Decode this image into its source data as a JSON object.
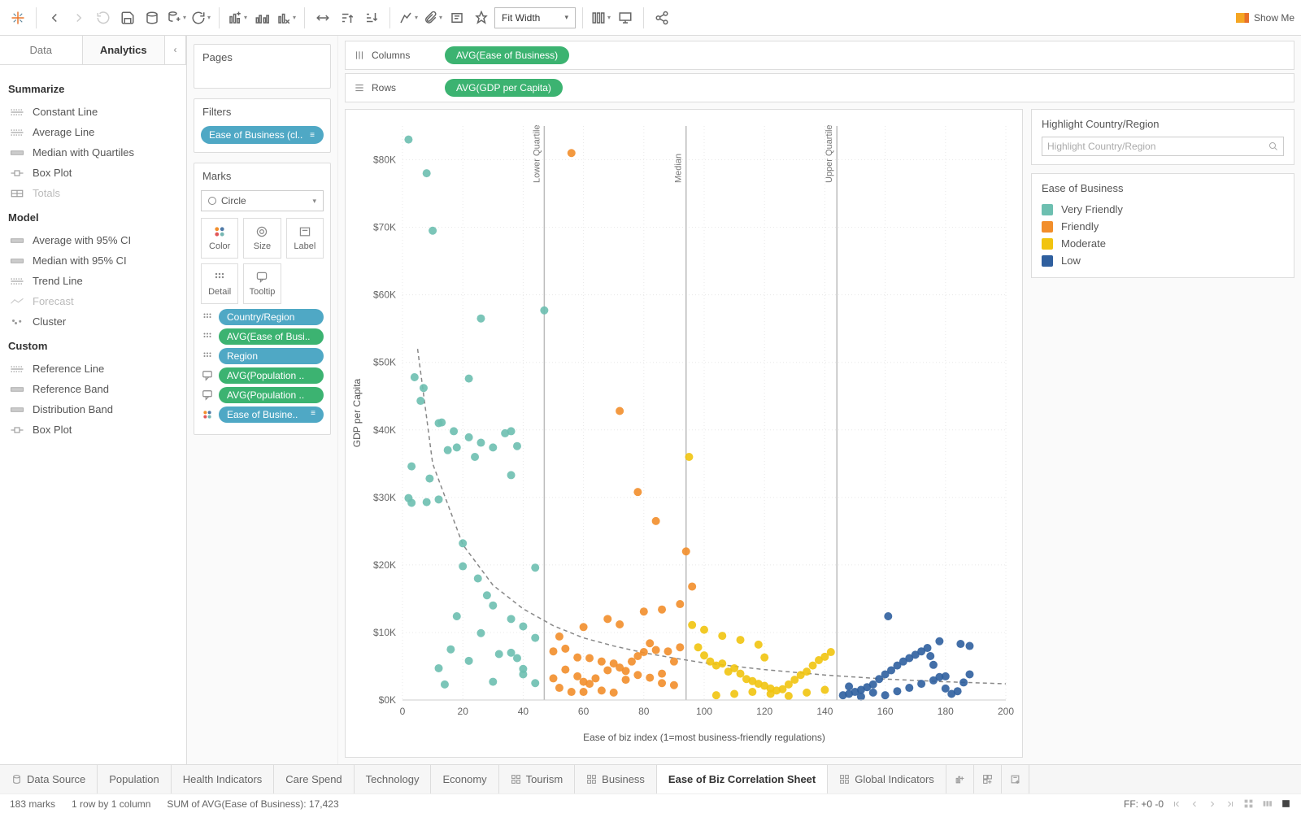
{
  "toolbar": {
    "fit_mode": "Fit Width",
    "show_me": "Show Me"
  },
  "sidepanel": {
    "tabs": {
      "data": "Data",
      "analytics": "Analytics"
    },
    "sections": {
      "summarize": {
        "title": "Summarize",
        "items": [
          "Constant Line",
          "Average Line",
          "Median with Quartiles",
          "Box Plot",
          "Totals"
        ]
      },
      "model": {
        "title": "Model",
        "items": [
          "Average with 95% CI",
          "Median with 95% CI",
          "Trend Line",
          "Forecast",
          "Cluster"
        ]
      },
      "custom": {
        "title": "Custom",
        "items": [
          "Reference Line",
          "Reference Band",
          "Distribution Band",
          "Box Plot"
        ]
      }
    }
  },
  "cards": {
    "pages": "Pages",
    "filters": {
      "title": "Filters",
      "pill": "Ease of Business (cl.."
    },
    "marks": {
      "title": "Marks",
      "type": "Circle",
      "cells": [
        "Color",
        "Size",
        "Label",
        "Detail",
        "Tooltip"
      ],
      "pills": [
        {
          "label": "Country/Region",
          "color": "blue",
          "icon": "detail"
        },
        {
          "label": "AVG(Ease of Busi..",
          "color": "green",
          "icon": "detail"
        },
        {
          "label": "Region",
          "color": "blue",
          "icon": "detail"
        },
        {
          "label": "AVG(Population ..",
          "color": "green",
          "icon": "tooltip"
        },
        {
          "label": "AVG(Population ..",
          "color": "green",
          "icon": "tooltip"
        },
        {
          "label": "Ease of Busine..",
          "color": "blue",
          "icon": "color",
          "bars": true
        }
      ]
    }
  },
  "shelves": {
    "columns": {
      "label": "Columns",
      "pill": "AVG(Ease of Business)"
    },
    "rows": {
      "label": "Rows",
      "pill": "AVG(GDP per Capita)"
    }
  },
  "right": {
    "highlight": {
      "title": "Highlight Country/Region",
      "placeholder": "Highlight Country/Region"
    },
    "legend": {
      "title": "Ease of Business",
      "items": [
        {
          "label": "Very Friendly",
          "color": "#6dbfb0"
        },
        {
          "label": "Friendly",
          "color": "#f28e2b"
        },
        {
          "label": "Moderate",
          "color": "#f1c40f"
        },
        {
          "label": "Low",
          "color": "#2f5f9e"
        }
      ]
    }
  },
  "bottom_tabs": {
    "data_source": "Data Source",
    "sheets": [
      "Population",
      "Health Indicators",
      "Care Spend",
      "Technology",
      "Economy",
      "Tourism",
      "Business",
      "Ease of Biz Correlation Sheet",
      "Global Indicators"
    ],
    "active": "Ease of Biz Correlation Sheet"
  },
  "status": {
    "marks": "183 marks",
    "rowcol": "1 row by 1 column",
    "sum": "SUM of AVG(Ease of Business): 17,423",
    "ff": "FF: +0 -0"
  },
  "chart_data": {
    "type": "scatter",
    "xlabel": "Ease of biz index (1=most business-friendly regulations)",
    "ylabel": "GDP per Capita",
    "xlim": [
      0,
      200
    ],
    "ylim": [
      0,
      85000
    ],
    "x_ticks": [
      0,
      20,
      40,
      60,
      80,
      100,
      120,
      140,
      160,
      180,
      200
    ],
    "y_ticks": [
      0,
      10000,
      20000,
      30000,
      40000,
      50000,
      60000,
      70000,
      80000
    ],
    "y_tick_labels": [
      "$0K",
      "$10K",
      "$20K",
      "$30K",
      "$40K",
      "$50K",
      "$60K",
      "$70K",
      "$80K"
    ],
    "reference_lines": [
      {
        "x": 47,
        "label": "Lower Quartile"
      },
      {
        "x": 94,
        "label": "Median"
      },
      {
        "x": 144,
        "label": "Upper Quartile"
      }
    ],
    "trend": {
      "type": "power",
      "points": [
        [
          5,
          52000
        ],
        [
          10,
          35000
        ],
        [
          20,
          23000
        ],
        [
          30,
          17000
        ],
        [
          40,
          13500
        ],
        [
          50,
          11000
        ],
        [
          60,
          9200
        ],
        [
          70,
          8000
        ],
        [
          80,
          7000
        ],
        [
          90,
          6200
        ],
        [
          100,
          5500
        ],
        [
          110,
          5000
        ],
        [
          120,
          4500
        ],
        [
          130,
          4100
        ],
        [
          140,
          3700
        ],
        [
          150,
          3400
        ],
        [
          160,
          3100
        ],
        [
          170,
          2900
        ],
        [
          180,
          2700
        ],
        [
          190,
          2550
        ],
        [
          200,
          2400
        ]
      ]
    },
    "series": [
      {
        "name": "Very Friendly",
        "color": "#6dbfb0",
        "points": [
          [
            2,
            83000
          ],
          [
            8,
            78000
          ],
          [
            4,
            47800
          ],
          [
            7,
            46200
          ],
          [
            6,
            44300
          ],
          [
            12,
            41000
          ],
          [
            13,
            41100
          ],
          [
            17,
            39800
          ],
          [
            10,
            69500
          ],
          [
            26,
            56500
          ],
          [
            47,
            57700
          ],
          [
            15,
            37000
          ],
          [
            18,
            37400
          ],
          [
            22,
            38900
          ],
          [
            26,
            38100
          ],
          [
            30,
            37400
          ],
          [
            34,
            39500
          ],
          [
            36,
            39800
          ],
          [
            38,
            37600
          ],
          [
            24,
            36000
          ],
          [
            3,
            34600
          ],
          [
            8,
            29300
          ],
          [
            12,
            29700
          ],
          [
            20,
            23200
          ],
          [
            25,
            18000
          ],
          [
            28,
            15500
          ],
          [
            30,
            14000
          ],
          [
            36,
            12000
          ],
          [
            40,
            10900
          ],
          [
            44,
            9200
          ],
          [
            26,
            9900
          ],
          [
            40,
            4600
          ],
          [
            32,
            6800
          ],
          [
            36,
            7000
          ],
          [
            38,
            6200
          ],
          [
            40,
            3800
          ],
          [
            44,
            2500
          ],
          [
            12,
            4700
          ],
          [
            16,
            7500
          ],
          [
            22,
            5800
          ],
          [
            30,
            2700
          ],
          [
            14,
            2300
          ],
          [
            18,
            12400
          ],
          [
            22,
            47600
          ],
          [
            20,
            19800
          ],
          [
            44,
            19600
          ],
          [
            36,
            33300
          ],
          [
            9,
            32800
          ],
          [
            2,
            29900
          ],
          [
            3,
            29200
          ]
        ]
      },
      {
        "name": "Friendly",
        "color": "#f28e2b",
        "points": [
          [
            56,
            81000
          ],
          [
            72,
            42800
          ],
          [
            78,
            30800
          ],
          [
            84,
            26500
          ],
          [
            94,
            22000
          ],
          [
            96,
            16800
          ],
          [
            86,
            13400
          ],
          [
            92,
            14200
          ],
          [
            80,
            13100
          ],
          [
            72,
            11200
          ],
          [
            68,
            12000
          ],
          [
            60,
            10800
          ],
          [
            52,
            9400
          ],
          [
            54,
            7600
          ],
          [
            58,
            6300
          ],
          [
            62,
            6200
          ],
          [
            66,
            5700
          ],
          [
            70,
            5400
          ],
          [
            74,
            4300
          ],
          [
            78,
            3700
          ],
          [
            82,
            3300
          ],
          [
            86,
            2500
          ],
          [
            90,
            2200
          ],
          [
            50,
            3200
          ],
          [
            52,
            1800
          ],
          [
            56,
            1200
          ],
          [
            60,
            2700
          ],
          [
            64,
            3200
          ],
          [
            68,
            4400
          ],
          [
            72,
            4800
          ],
          [
            76,
            5700
          ],
          [
            80,
            7100
          ],
          [
            84,
            7400
          ],
          [
            88,
            7200
          ],
          [
            92,
            7800
          ],
          [
            50,
            7200
          ],
          [
            54,
            4500
          ],
          [
            58,
            3500
          ],
          [
            62,
            2400
          ],
          [
            66,
            1400
          ],
          [
            70,
            1100
          ],
          [
            74,
            3000
          ],
          [
            78,
            6500
          ],
          [
            82,
            8400
          ],
          [
            86,
            3900
          ],
          [
            90,
            5700
          ],
          [
            60,
            1200
          ]
        ]
      },
      {
        "name": "Moderate",
        "color": "#f1c40f",
        "points": [
          [
            95,
            36000
          ],
          [
            98,
            7800
          ],
          [
            100,
            6600
          ],
          [
            102,
            5700
          ],
          [
            104,
            5100
          ],
          [
            106,
            5400
          ],
          [
            108,
            4200
          ],
          [
            110,
            4700
          ],
          [
            112,
            3900
          ],
          [
            114,
            3100
          ],
          [
            116,
            2800
          ],
          [
            118,
            2400
          ],
          [
            120,
            2100
          ],
          [
            122,
            1700
          ],
          [
            124,
            1400
          ],
          [
            126,
            1600
          ],
          [
            128,
            2300
          ],
          [
            130,
            3000
          ],
          [
            132,
            3700
          ],
          [
            134,
            4200
          ],
          [
            136,
            5100
          ],
          [
            138,
            5900
          ],
          [
            140,
            6400
          ],
          [
            142,
            7100
          ],
          [
            118,
            8200
          ],
          [
            112,
            8900
          ],
          [
            106,
            9500
          ],
          [
            100,
            10400
          ],
          [
            96,
            11100
          ],
          [
            104,
            700
          ],
          [
            110,
            900
          ],
          [
            116,
            1200
          ],
          [
            122,
            900
          ],
          [
            128,
            600
          ],
          [
            134,
            1100
          ],
          [
            140,
            1500
          ],
          [
            120,
            6300
          ]
        ]
      },
      {
        "name": "Low",
        "color": "#2f5f9e",
        "points": [
          [
            146,
            700
          ],
          [
            148,
            900
          ],
          [
            150,
            1200
          ],
          [
            152,
            1500
          ],
          [
            154,
            1900
          ],
          [
            156,
            2300
          ],
          [
            158,
            3100
          ],
          [
            160,
            3800
          ],
          [
            162,
            4400
          ],
          [
            164,
            5100
          ],
          [
            166,
            5700
          ],
          [
            168,
            6200
          ],
          [
            170,
            6700
          ],
          [
            172,
            7200
          ],
          [
            174,
            7700
          ],
          [
            176,
            5200
          ],
          [
            178,
            3400
          ],
          [
            180,
            1700
          ],
          [
            182,
            900
          ],
          [
            184,
            1300
          ],
          [
            186,
            2600
          ],
          [
            188,
            3800
          ],
          [
            161,
            12400
          ],
          [
            175,
            6500
          ],
          [
            185,
            8300
          ],
          [
            188,
            8000
          ],
          [
            178,
            8700
          ],
          [
            148,
            2000
          ],
          [
            152,
            500
          ],
          [
            156,
            1100
          ],
          [
            160,
            700
          ],
          [
            164,
            1300
          ],
          [
            168,
            1800
          ],
          [
            172,
            2400
          ],
          [
            176,
            2900
          ],
          [
            180,
            3500
          ]
        ]
      }
    ]
  }
}
